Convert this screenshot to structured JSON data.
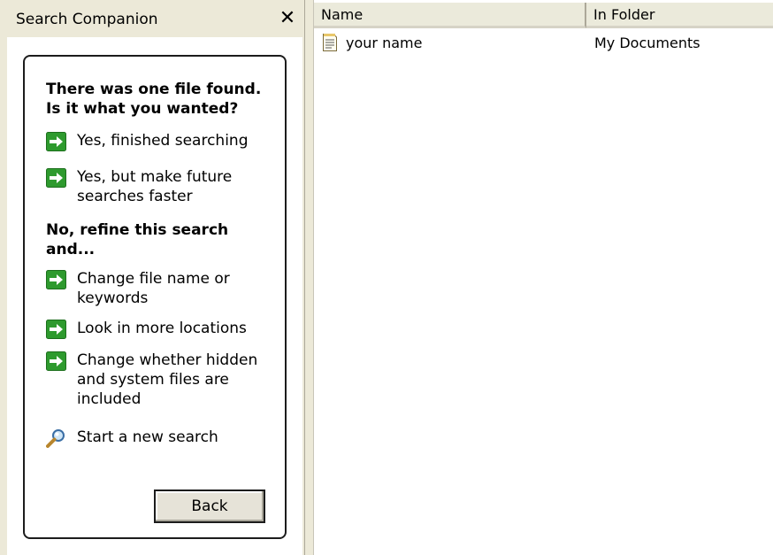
{
  "companion": {
    "title": "Search Companion",
    "close_label": "✕",
    "heading1": "There was one file found. Is it what you wanted?",
    "options1": [
      {
        "label": "Yes, finished searching"
      },
      {
        "label": "Yes, but make future searches faster"
      }
    ],
    "heading2": "No, refine this search and...",
    "options2": [
      {
        "label": "Change file name or keywords"
      },
      {
        "label": "Look in more locations"
      },
      {
        "label": "Change whether hidden and system files are included"
      }
    ],
    "new_search_label": "Start a new search",
    "back_label": "Back",
    "arrow_icon": "green-arrow-icon",
    "search_icon": "magnifier-icon"
  },
  "results": {
    "columns": [
      "Name",
      "In Folder"
    ],
    "rows": [
      {
        "name": "your name",
        "folder": "My Documents",
        "icon": "text-file-icon"
      }
    ]
  },
  "colors": {
    "pane_background": "#ece9d8",
    "arrow_green": "#2e9a2e"
  }
}
